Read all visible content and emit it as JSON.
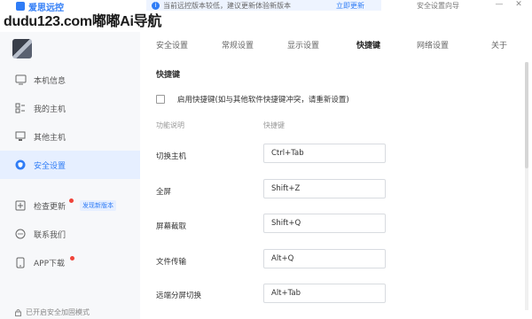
{
  "app": {
    "brand_name": "爱思远控"
  },
  "notice": {
    "text": "当前远控版本较低，建议更新体验新版本",
    "link": "立即更新"
  },
  "top_right": {
    "link": "安全设置向导"
  },
  "watermark": {
    "text": "dudu123.com嘟嘟Ai导航"
  },
  "sidebar": {
    "items": [
      {
        "label": "本机信息",
        "icon": "monitor-icon"
      },
      {
        "label": "我的主机",
        "icon": "hosts-icon"
      },
      {
        "label": "其他主机",
        "icon": "computer-icon"
      },
      {
        "label": "安全设置",
        "icon": "shield-icon"
      },
      {
        "label": "检查更新",
        "icon": "update-icon",
        "badge": "发现新版本"
      },
      {
        "label": "联系我们",
        "icon": "chat-icon"
      },
      {
        "label": "APP下载",
        "icon": "phone-icon"
      }
    ],
    "footer": "已开启安全加固模式"
  },
  "tabs": [
    {
      "label": "安全设置"
    },
    {
      "label": "常规设置"
    },
    {
      "label": "显示设置"
    },
    {
      "label": "快捷键"
    },
    {
      "label": "网络设置"
    },
    {
      "label": "关于"
    }
  ],
  "content": {
    "section_title": "快捷键",
    "enable_label": "启用快捷键(如与其他软件快捷键冲突，请重新设置)",
    "col_function": "功能说明",
    "col_shortcut": "快捷键",
    "rows": [
      {
        "label": "切换主机",
        "shortcut": "Ctrl+Tab"
      },
      {
        "label": "全屏",
        "shortcut": "Shift+Z"
      },
      {
        "label": "屏幕截取",
        "shortcut": "Shift+Q"
      },
      {
        "label": "文件传输",
        "shortcut": "Alt+Q"
      },
      {
        "label": "远端分屏切换",
        "shortcut": "Alt+Tab"
      }
    ]
  },
  "colors": {
    "accent": "#2f7cf6",
    "active_bg": "#e6efff",
    "badge_dot": "#f0443a"
  }
}
